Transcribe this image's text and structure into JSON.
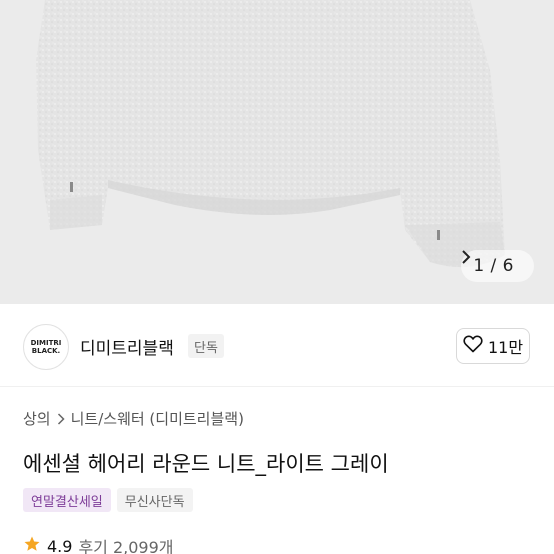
{
  "gallery": {
    "counter": "1 / 6",
    "background": "#ebebeb"
  },
  "brand": {
    "logo_line1": "DIMITRI",
    "logo_line2": "BLACK.",
    "name": "디미트리블랙",
    "badge": "단독",
    "likes": "11만"
  },
  "breadcrumb": {
    "category": "상의",
    "subcategory": "니트/스웨터 (디미트리블랙)"
  },
  "product": {
    "title": "에센셜 헤어리 라운드 니트_라이트 그레이",
    "tags": [
      "연말결산세일",
      "무신사단독"
    ]
  },
  "rating": {
    "score": "4.9",
    "reviews": "후기 2,099개",
    "star_color": "#f5a623"
  }
}
